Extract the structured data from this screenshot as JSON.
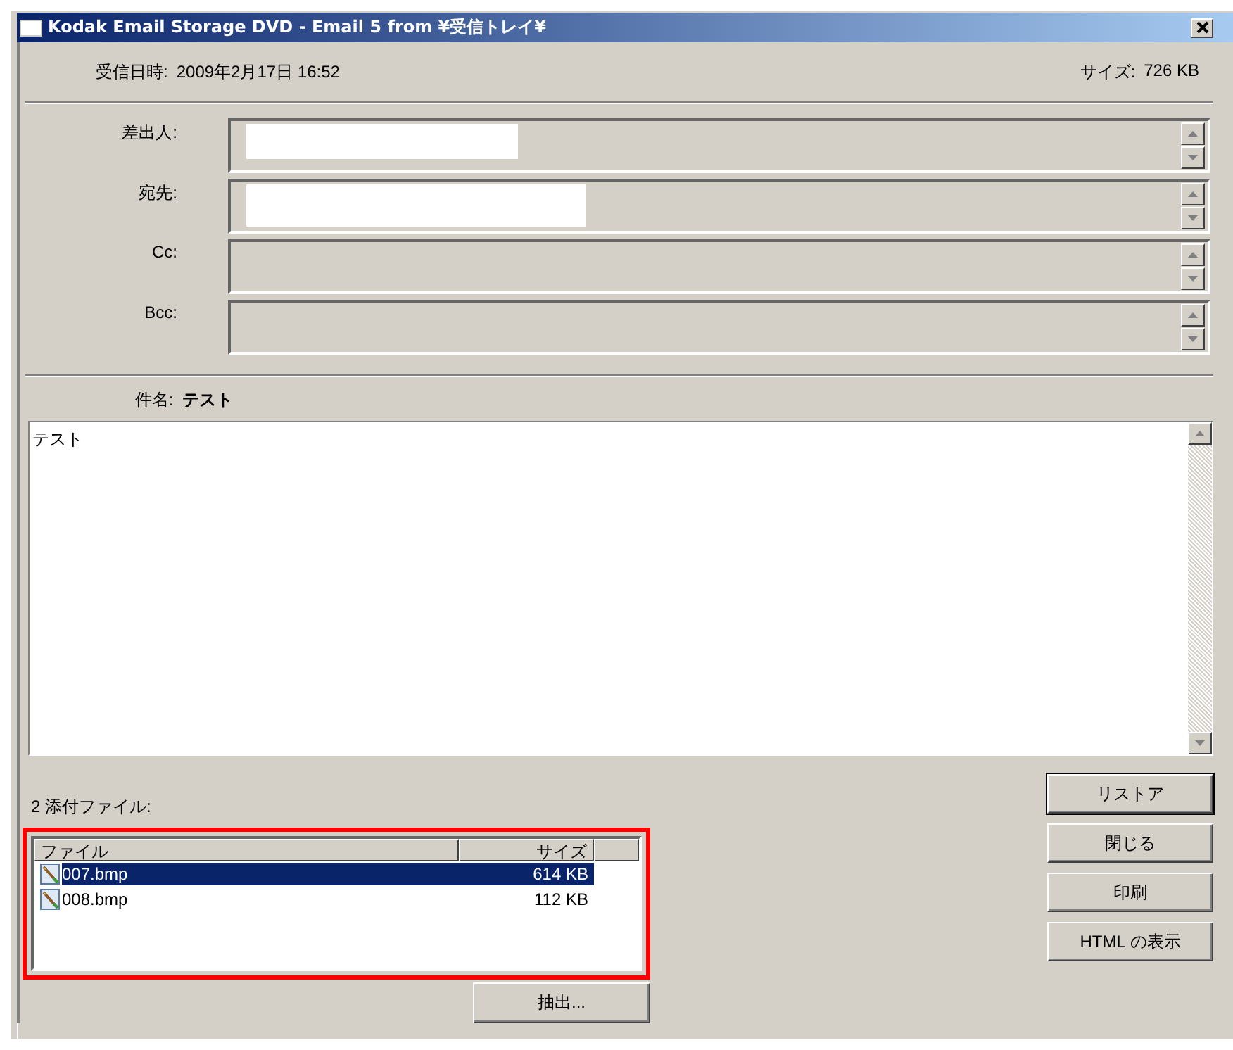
{
  "window": {
    "title": "Kodak Email Storage DVD - Email 5 from ¥受信トレイ¥"
  },
  "received": {
    "label": "受信日時:",
    "value": "2009年2月17日 16:52"
  },
  "size": {
    "label": "サイズ:",
    "value": "726 KB"
  },
  "address_fields": [
    {
      "label": "差出人:",
      "redacted": true
    },
    {
      "label": "宛先:",
      "redacted": true
    },
    {
      "label": "Cc:",
      "redacted": false
    },
    {
      "label": "Bcc:",
      "redacted": false
    }
  ],
  "subject": {
    "label": "件名:",
    "value": "テスト"
  },
  "body": "テスト",
  "attachments": {
    "label": "2 添付ファイル:",
    "highlighted": true,
    "columns": [
      "ファイル",
      "サイズ"
    ],
    "rows": [
      {
        "name": "007.bmp",
        "size": "614 KB",
        "selected": true
      },
      {
        "name": "008.bmp",
        "size": "112 KB",
        "selected": false
      }
    ],
    "extract_button": "抽出..."
  },
  "buttons": [
    {
      "label": "リストア",
      "default": true
    },
    {
      "label": "閉じる",
      "default": false
    },
    {
      "label": "印刷",
      "default": false
    },
    {
      "label": "HTML の表示",
      "default": false
    }
  ]
}
